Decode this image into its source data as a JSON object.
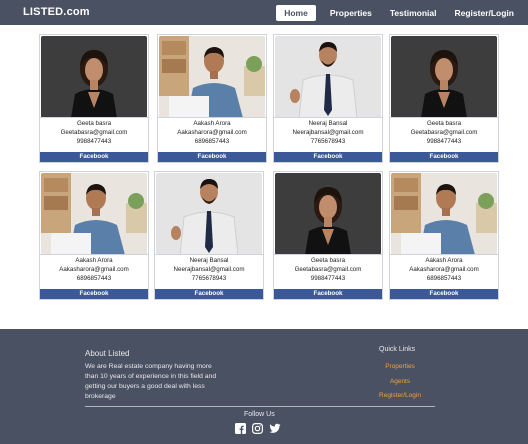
{
  "brand": "LISTED.com",
  "nav": {
    "home": "Home",
    "properties": "Properties",
    "testimonial": "Testimonial",
    "register": "Register/Login"
  },
  "cards": [
    {
      "name": "Geeta basra",
      "email": "Geetabasra@gmail.com",
      "phone": "9988477443",
      "button": "Facebook",
      "photo": "woman-black-blazer"
    },
    {
      "name": "Aakash Arora",
      "email": "Aakasharora@gmail.com",
      "phone": "6896857443",
      "button": "Facebook",
      "photo": "man-blue-shirt-office"
    },
    {
      "name": "Neeraj Bansal",
      "email": "Neerajbansal@gmail.com",
      "phone": "7765678943",
      "button": "Facebook",
      "photo": "man-white-shirt-tie"
    },
    {
      "name": "Geeta basra",
      "email": "Geetabasra@gmail.com",
      "phone": "9988477443",
      "button": "Facebook",
      "photo": "woman-black-blazer"
    },
    {
      "name": "Aakash Arora",
      "email": "Aakasharora@gmail.com",
      "phone": "6896857443",
      "button": "Facebook",
      "photo": "man-blue-shirt-office"
    },
    {
      "name": "Neeraj Bansal",
      "email": "Neerajbansal@gmail.com",
      "phone": "7765678943",
      "button": "Facebook",
      "photo": "man-white-shirt-tie"
    },
    {
      "name": "Geeta basra",
      "email": "Geetabasra@gmail.com",
      "phone": "9988477443",
      "button": "Facebook",
      "photo": "woman-black-blazer"
    },
    {
      "name": "Aakash Arora",
      "email": "Aakasharora@gmail.com",
      "phone": "6896857443",
      "button": "Facebook",
      "photo": "man-blue-shirt-office"
    }
  ],
  "footer": {
    "about_title": "About Listed",
    "about_text": "We are Real estate company having more than 10 years of experience in this field and getting our buyers a good deal with less brokerage",
    "quick_title": "Quick Links",
    "links": [
      "Properties",
      "Agents",
      "Register/Login"
    ],
    "follow": "Follow Us"
  },
  "colors": {
    "navbar": "#4a5163",
    "facebook": "#3b5998",
    "link": "#f0a040"
  },
  "icons": [
    "facebook-icon",
    "instagram-icon",
    "twitter-icon"
  ]
}
